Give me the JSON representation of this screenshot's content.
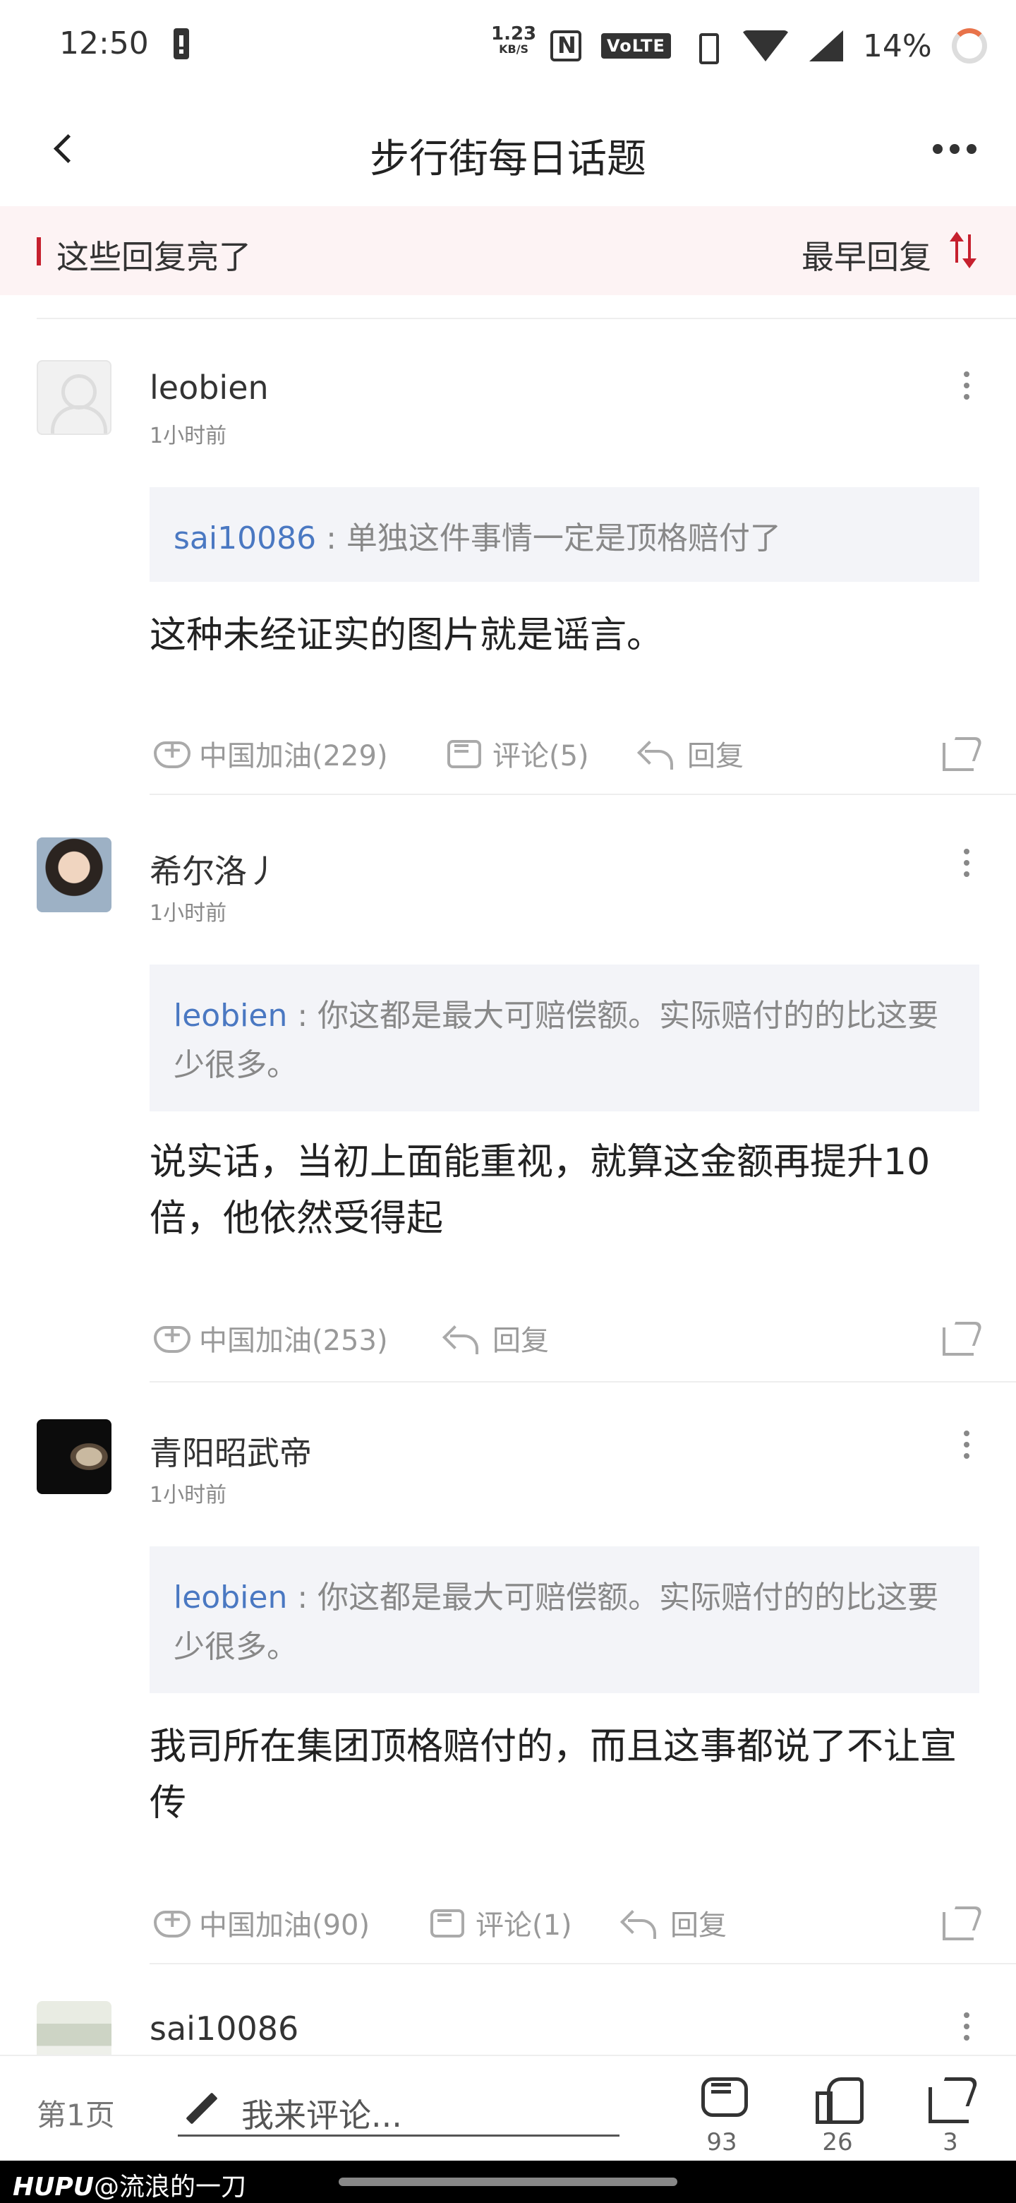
{
  "status_bar": {
    "time": "12:50",
    "net_speed": "1.23",
    "net_speed_unit": "KB/S",
    "volte": "VoLTE",
    "battery": "14%"
  },
  "header": {
    "title": "步行街每日话题",
    "back_icon": "chevron-left-icon",
    "more_icon": "more-horizontal-icon"
  },
  "section": {
    "label": "这些回复亮了",
    "sort_label": "最早回复",
    "accent_color": "#c6202e"
  },
  "posts": [
    {
      "username": "leobien",
      "time": "1小时前",
      "quote_user": "sai10086",
      "quote_text": " : 单独这件事情一定是顶格赔付了",
      "content": "这种未经证实的图片就是谣言。",
      "like_label": "中国加油(229)",
      "comment_label": "评论(5)",
      "reply_label": "回复"
    },
    {
      "username": "希尔洛丿",
      "time": "1小时前",
      "quote_user": "leobien",
      "quote_text": " : 你这都是最大可赔偿额。实际赔付的的比这要少很多。",
      "content": "说实话，当初上面能重视，就算这金额再提升10倍，他依然受得起",
      "like_label": "中国加油(253)",
      "reply_label": "回复"
    },
    {
      "username": "青阳昭武帝",
      "time": "1小时前",
      "quote_user": "leobien",
      "quote_text": " : 你这都是最大可赔偿额。实际赔付的的比这要少很多。",
      "content": "我司所在集团顶格赔付的，而且这事都说了不让宣传",
      "like_label": "中国加油(90)",
      "comment_label": "评论(1)",
      "reply_label": "回复"
    },
    {
      "username": "sai10086"
    }
  ],
  "bottom_bar": {
    "page": "第1页",
    "comment_placeholder": "我来评论...",
    "comment_count": "93",
    "like_count": "26",
    "share_count": "3"
  },
  "watermark": {
    "logo": "HUPU",
    "text": "@流浪的一刀"
  },
  "colors": {
    "link_blue": "#4a78c2",
    "quote_bg": "#f3f4f8",
    "section_bg": "#fdf3f4"
  }
}
